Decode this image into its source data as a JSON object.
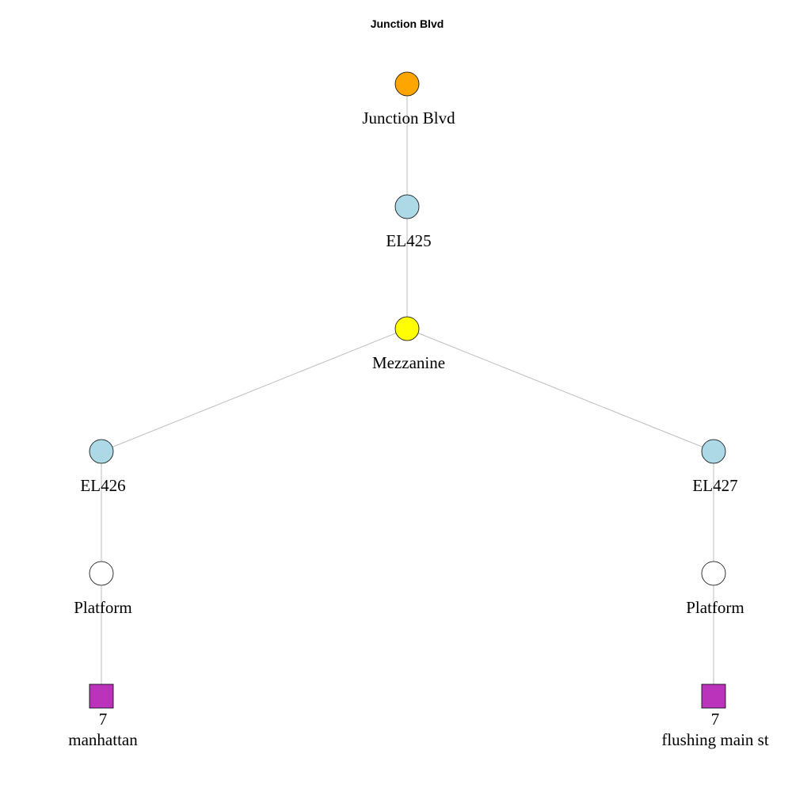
{
  "title": "Junction Blvd",
  "colors": {
    "station": "#FFA500",
    "elevator": "#ADD8E6",
    "mezzanine": "#FFFF00",
    "platform": "#FFFFFF",
    "route": "#BB33BB",
    "edge": "#BDBDBD"
  },
  "nodes": [
    {
      "id": "junction-blvd",
      "kind": "station",
      "shape": "circle",
      "label_lines": [
        "Junction Blvd"
      ]
    },
    {
      "id": "el425",
      "kind": "elevator",
      "shape": "circle",
      "label_lines": [
        "EL425"
      ]
    },
    {
      "id": "mezzanine",
      "kind": "mezzanine",
      "shape": "circle",
      "label_lines": [
        "Mezzanine"
      ]
    },
    {
      "id": "el426",
      "kind": "elevator",
      "shape": "circle",
      "label_lines": [
        "EL426"
      ]
    },
    {
      "id": "el427",
      "kind": "elevator",
      "shape": "circle",
      "label_lines": [
        "EL427"
      ]
    },
    {
      "id": "platform-left",
      "kind": "platform",
      "shape": "circle",
      "label_lines": [
        "Platform"
      ]
    },
    {
      "id": "platform-right",
      "kind": "platform",
      "shape": "circle",
      "label_lines": [
        "Platform"
      ]
    },
    {
      "id": "route-manhattan",
      "kind": "route",
      "shape": "square",
      "label_lines": [
        "7",
        "manhattan"
      ]
    },
    {
      "id": "route-flushing",
      "kind": "route",
      "shape": "square",
      "label_lines": [
        "7",
        "flushing main st"
      ]
    }
  ],
  "edges": [
    [
      "junction-blvd",
      "el425"
    ],
    [
      "el425",
      "mezzanine"
    ],
    [
      "mezzanine",
      "el426"
    ],
    [
      "mezzanine",
      "el427"
    ],
    [
      "el426",
      "platform-left"
    ],
    [
      "el427",
      "platform-right"
    ],
    [
      "platform-left",
      "route-manhattan"
    ],
    [
      "platform-right",
      "route-flushing"
    ]
  ]
}
